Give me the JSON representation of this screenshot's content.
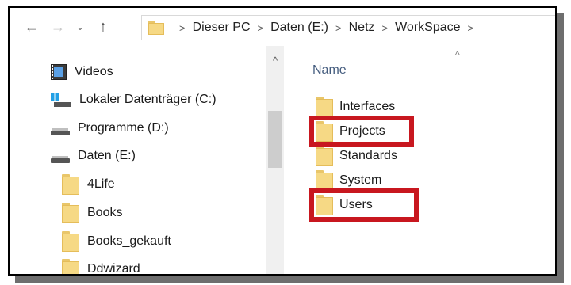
{
  "nav": {
    "back_icon": "arrow-left-icon",
    "forward_icon": "arrow-right-icon",
    "recent_icon": "chevron-down-icon",
    "up_icon": "arrow-up-icon"
  },
  "breadcrumb": [
    "Dieser PC",
    "Daten (E:)",
    "Netz",
    "WorkSpace"
  ],
  "sidebar": {
    "items": [
      {
        "label": "Videos",
        "icon": "video-folder-icon"
      },
      {
        "label": "Lokaler Datenträger (C:)",
        "icon": "windows-drive-icon"
      },
      {
        "label": "Programme (D:)",
        "icon": "drive-icon"
      },
      {
        "label": "Daten (E:)",
        "icon": "drive-icon"
      },
      {
        "label": "4Life",
        "icon": "folder-icon"
      },
      {
        "label": "Books",
        "icon": "folder-icon"
      },
      {
        "label": "Books_gekauft",
        "icon": "folder-icon"
      },
      {
        "label": "Ddwizard",
        "icon": "folder-icon"
      }
    ]
  },
  "content": {
    "column_header": "Name",
    "files": [
      {
        "name": "Interfaces",
        "highlighted": false
      },
      {
        "name": "Projects",
        "highlighted": true
      },
      {
        "name": "Standards",
        "highlighted": false
      },
      {
        "name": "System",
        "highlighted": false
      },
      {
        "name": "Users",
        "highlighted": true
      }
    ]
  },
  "colors": {
    "highlight": "#c8171f",
    "folder": "#f6d985",
    "header_text": "#445c7e"
  }
}
